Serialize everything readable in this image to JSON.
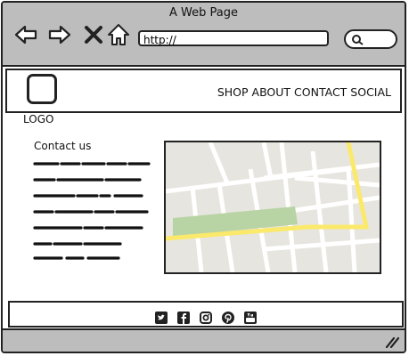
{
  "window": {
    "title": "A Web Page"
  },
  "toolbar": {
    "back_icon": "arrow-left-icon",
    "forward_icon": "arrow-right-icon",
    "close_icon": "close-x-icon",
    "home_icon": "home-icon",
    "url": "http://",
    "search_icon": "search-icon"
  },
  "header": {
    "logo_label": "LOGO",
    "menu": [
      "SHOP",
      "ABOUT",
      "CONTACT",
      "SOCIAL"
    ]
  },
  "contact": {
    "title": "Contact us"
  },
  "map": {
    "icon": "map-image"
  },
  "footer": {
    "social_icons": [
      "twitter-icon",
      "facebook-icon",
      "instagram-icon",
      "pinterest-icon",
      "youtube-icon"
    ]
  },
  "colors": {
    "chrome": "#bdbdbd",
    "map_bg": "#e7e5df",
    "map_road_yellow": "#fbe96b",
    "map_park": "#b8d3a4"
  }
}
